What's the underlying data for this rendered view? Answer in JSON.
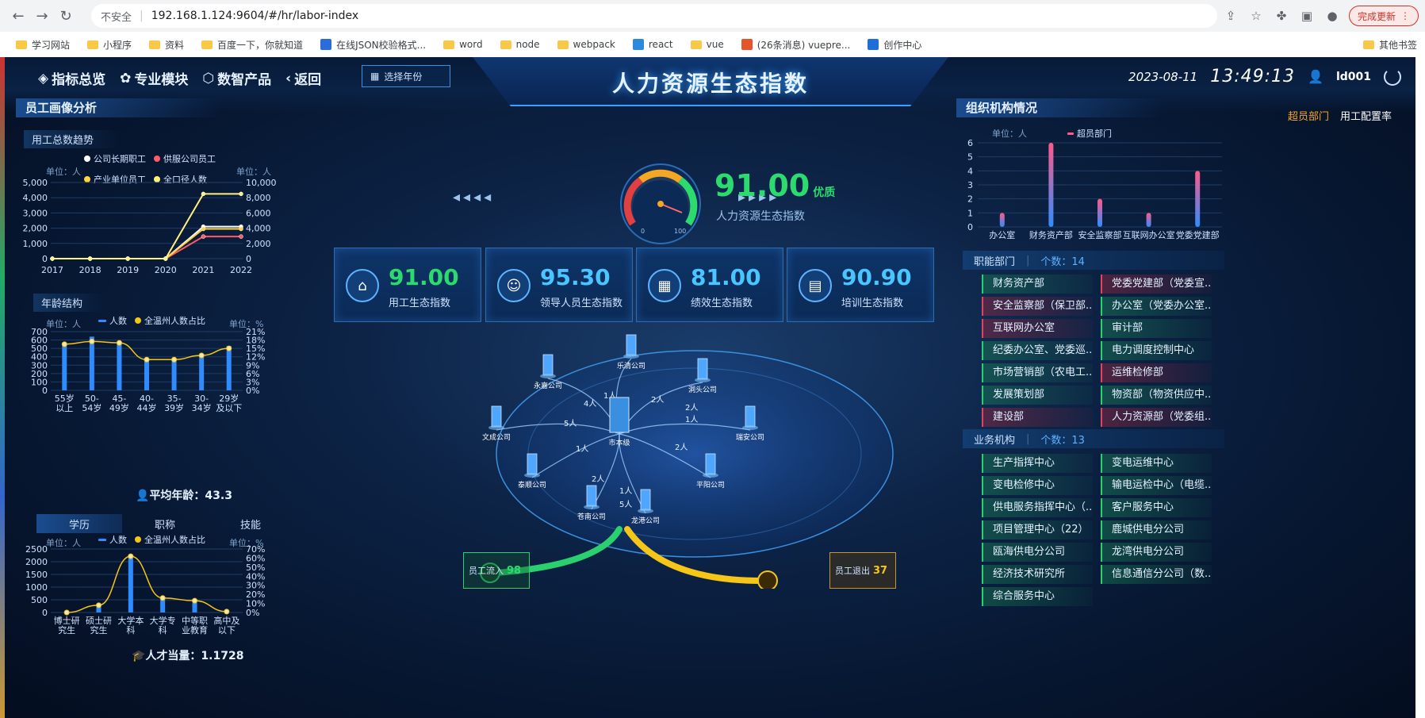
{
  "browser": {
    "security": "不安全",
    "url": "192.168.1.124:9604/#/hr/labor-index",
    "update_label": "完成更新",
    "bookmarks": [
      "学习网站",
      "小程序",
      "资料",
      "百度一下，你就知道",
      "在线JSON校验格式...",
      "word",
      "node",
      "webpack",
      "react",
      "vue",
      "(26条消息) vuepre...",
      "创作中心"
    ],
    "other_bookmarks": "其他书签"
  },
  "header": {
    "nav": [
      "指标总览",
      "专业模块",
      "数智产品",
      "返回"
    ],
    "year_select": "选择年份",
    "title": "人力资源生态指数",
    "date": "2023-08-11",
    "time": "13:49:13",
    "user": "ld001"
  },
  "left": {
    "section_title": "员工画像分析",
    "trend": {
      "title": "用工总数趋势",
      "unit_left": "单位：人",
      "unit_right": "单位：人",
      "legend": [
        "公司长期职工",
        "供服公司员工",
        "产业单位员工",
        "全口径人数"
      ],
      "legend_colors": [
        "#ffffff",
        "#ff5a6a",
        "#ffd23f",
        "#fff27a"
      ],
      "y_left": [
        "5,000",
        "4,000",
        "3,000",
        "2,000",
        "1,000",
        "0"
      ],
      "y_right": [
        "10,000",
        "8,000",
        "6,000",
        "4,000",
        "2,000",
        "0"
      ]
    },
    "age": {
      "title": "年龄结构",
      "unit_left": "单位：人",
      "unit_right": "单位：%",
      "legend": [
        "人数",
        "全温州人数占比"
      ],
      "y_left": [
        "700",
        "600",
        "500",
        "400",
        "300",
        "200",
        "100",
        "0"
      ],
      "y_right": [
        "21%",
        "18%",
        "15%",
        "12%",
        "9%",
        "6%",
        "3%",
        "0%"
      ],
      "avg_label": "平均年龄：43.3"
    },
    "edu_tabs": [
      "学历",
      "职称",
      "技能"
    ],
    "edu": {
      "unit_left": "单位：人",
      "unit_right": "单位：%",
      "legend": [
        "人数",
        "全温州人数占比"
      ],
      "y_left": [
        "2500",
        "2000",
        "1500",
        "1000",
        "500",
        "0"
      ],
      "y_right": [
        "70%",
        "60%",
        "50%",
        "40%",
        "30%",
        "20%",
        "10%",
        "0%"
      ],
      "talent_label": "人才当量：1.1728"
    }
  },
  "center": {
    "score": "91.00",
    "grade": "优质",
    "score_label": "人力资源生态指数",
    "gauge_min": "0",
    "gauge_max": "100",
    "cards": [
      {
        "value": "91.00",
        "label": "用工生态指数",
        "color": "#2bdb6e",
        "icon": "home-icon"
      },
      {
        "value": "95.30",
        "label": "领导人员生态指数",
        "color": "#49c6ff",
        "icon": "person-icon"
      },
      {
        "value": "81.00",
        "label": "绩效生态指数",
        "color": "#49c6ff",
        "icon": "grid-icon"
      },
      {
        "value": "90.90",
        "label": "培训生态指数",
        "color": "#49c6ff",
        "icon": "book-icon"
      }
    ],
    "hub": "市本级",
    "companies": [
      "乐清公司",
      "永嘉公司",
      "洞头公司",
      "文成公司",
      "瑞安公司",
      "泰顺公司",
      "平阳公司",
      "苍南公司",
      "龙港公司"
    ],
    "flows": [
      "1人",
      "4人",
      "2人",
      "2人",
      "1人",
      "5人",
      "1人",
      "2人",
      "2人",
      "1人",
      "5人"
    ],
    "inflow_label": "员工流入",
    "inflow_value": "98",
    "outflow_label": "员工退出",
    "outflow_value": "37"
  },
  "right": {
    "section_title": "组织机构情况",
    "tabs": [
      "超员部门",
      "用工配置率"
    ],
    "unit": "单位：人",
    "legend": "超员部门",
    "y_ticks": [
      "6",
      "5",
      "4",
      "3",
      "2",
      "1",
      "0"
    ],
    "functional": {
      "label": "职能部门",
      "count": "个数：14",
      "items": [
        {
          "name": "财务资产部",
          "type": "g"
        },
        {
          "name": "党委党建部（党委宣...",
          "type": "r"
        },
        {
          "name": "安全监察部（保卫部...",
          "type": "r"
        },
        {
          "name": "办公室（党委办公室...",
          "type": "g"
        },
        {
          "name": "互联网办公室",
          "type": "r"
        },
        {
          "name": "审计部",
          "type": "g"
        },
        {
          "name": "纪委办公室、党委巡...",
          "type": "g"
        },
        {
          "name": "电力调度控制中心",
          "type": "g"
        },
        {
          "name": "市场营销部（农电工...",
          "type": "g"
        },
        {
          "name": "运维检修部",
          "type": "r"
        },
        {
          "name": "发展策划部",
          "type": "g"
        },
        {
          "name": "物资部（物资供应中...",
          "type": "g"
        },
        {
          "name": "建设部",
          "type": "r"
        },
        {
          "name": "人力资源部（党委组...",
          "type": "r"
        }
      ]
    },
    "business": {
      "label": "业务机构",
      "count": "个数：13",
      "items": [
        {
          "name": "生产指挥中心",
          "type": "g"
        },
        {
          "name": "变电运维中心",
          "type": "g"
        },
        {
          "name": "变电检修中心",
          "type": "g"
        },
        {
          "name": "输电运检中心（电缆...",
          "type": "g"
        },
        {
          "name": "供电服务指挥中心（...",
          "type": "g"
        },
        {
          "name": "客户服务中心",
          "type": "g"
        },
        {
          "name": "项目管理中心（22）",
          "type": "g"
        },
        {
          "name": "鹿城供电分公司",
          "type": "g"
        },
        {
          "name": "瓯海供电分公司",
          "type": "g"
        },
        {
          "name": "龙湾供电分公司",
          "type": "g"
        },
        {
          "name": "经济技术研究所",
          "type": "g"
        },
        {
          "name": "信息通信分公司（数...",
          "type": "g"
        },
        {
          "name": "综合服务中心",
          "type": "g"
        }
      ]
    }
  },
  "chart_data": [
    {
      "type": "line",
      "title": "用工总数趋势",
      "x": [
        "2017",
        "2018",
        "2019",
        "2020",
        "2021",
        "2022"
      ],
      "series": [
        {
          "name": "公司长期职工",
          "values": [
            0,
            0,
            0,
            0,
            4200,
            4200
          ]
        },
        {
          "name": "供服公司员工",
          "values": [
            0,
            0,
            0,
            0,
            2900,
            2900
          ]
        },
        {
          "name": "产业单位员工",
          "values": [
            0,
            0,
            0,
            0,
            3900,
            3900
          ]
        },
        {
          "name": "全口径人数",
          "values": [
            0,
            0,
            0,
            0,
            8500,
            8500
          ]
        }
      ],
      "ylim_left": [
        0,
        5000
      ],
      "ylim_right": [
        0,
        10000
      ]
    },
    {
      "type": "bar",
      "title": "年龄结构",
      "categories": [
        "55岁以上",
        "50-54岁",
        "45-49岁",
        "40-44岁",
        "35-39岁",
        "30-34岁",
        "29岁及以下"
      ],
      "series": [
        {
          "name": "人数",
          "values": [
            560,
            640,
            570,
            370,
            370,
            420,
            530
          ]
        },
        {
          "name": "全温州人数占比",
          "values": [
            16.5,
            17.5,
            17,
            11,
            11,
            12.5,
            15
          ]
        }
      ],
      "ylim_left": [
        0,
        700
      ],
      "ylim_right": [
        0,
        21
      ]
    },
    {
      "type": "bar",
      "title": "学历",
      "categories": [
        "博士研究生",
        "硕士研究生",
        "大学本科",
        "大学专科",
        "中等职业教育",
        "高中及以下"
      ],
      "series": [
        {
          "name": "人数",
          "values": [
            20,
            300,
            2220,
            550,
            400,
            50
          ]
        },
        {
          "name": "全温州人数占比",
          "values": [
            0,
            8,
            62,
            16,
            13,
            1
          ]
        }
      ],
      "ylim_left": [
        0,
        2500
      ],
      "ylim_right": [
        0,
        70
      ]
    },
    {
      "type": "bar",
      "title": "超员部门",
      "categories": [
        "办公室",
        "财务资产部",
        "安全监察部",
        "互联网办公室",
        "党委党建部"
      ],
      "series": [
        {
          "name": "超员部门",
          "values": [
            1,
            6,
            2,
            1,
            4
          ]
        }
      ],
      "ylim": [
        0,
        6
      ]
    }
  ]
}
